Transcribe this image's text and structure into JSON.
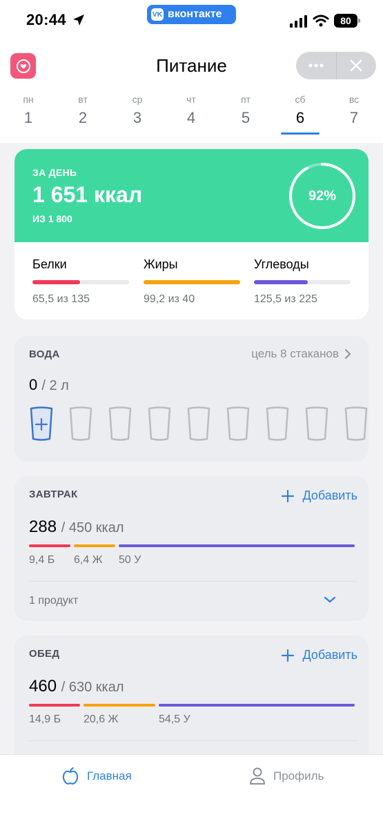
{
  "status_bar": {
    "time": "20:44",
    "app_pill": "вконтакте",
    "battery": "80"
  },
  "header": {
    "title": "Питание",
    "more_icon": "ellipsis-icon",
    "close_icon": "close-icon"
  },
  "days": [
    {
      "name": "пн",
      "date": "1"
    },
    {
      "name": "вт",
      "date": "2"
    },
    {
      "name": "ср",
      "date": "3"
    },
    {
      "name": "чт",
      "date": "4"
    },
    {
      "name": "пт",
      "date": "5"
    },
    {
      "name": "сб",
      "date": "6",
      "active": true
    },
    {
      "name": "вс",
      "date": "7"
    }
  ],
  "summary": {
    "label": "ЗА ДЕНЬ",
    "value": "1 651 ккал",
    "of": "ИЗ 1 800",
    "percent_text": "92%",
    "percent": 0.92,
    "bg_color": "#3fd9a0",
    "macros": [
      {
        "name": "Белки",
        "value": "65,5 из 135",
        "fill": 0.49,
        "color": "#f23a55"
      },
      {
        "name": "Жиры",
        "value": "99,2 из 40",
        "fill": 1.0,
        "color": "#f5a30f"
      },
      {
        "name": "Углеводы",
        "value": "125,5 из 225",
        "fill": 0.56,
        "color": "#6b5ad8"
      }
    ]
  },
  "water": {
    "title": "ВОДА",
    "goal": "цель 8 стаканов",
    "amount": "0",
    "total": "/ 2 л",
    "glasses_count": 9
  },
  "breakfast": {
    "title": "ЗАВТРАК",
    "add_label": "Добавить",
    "kcal": "288",
    "kcal_total": "/ 450 ккал",
    "protein": "9,4 Б",
    "fat": "6,4 Ж",
    "carbs": "50 У",
    "products": "1 продукт"
  },
  "lunch": {
    "title": "ОБЕД",
    "add_label": "Добавить",
    "kcal": "460",
    "kcal_total": "/ 630 ккал",
    "protein": "14,9 Б",
    "fat": "20,6 Ж",
    "carbs": "54,5 У"
  },
  "tabbar": {
    "home": "Главная",
    "profile": "Профиль"
  },
  "colors": {
    "accent": "#2d81e0",
    "protein": "#f23a55",
    "fat": "#f5a30f",
    "carbs": "#6b5ad8"
  }
}
